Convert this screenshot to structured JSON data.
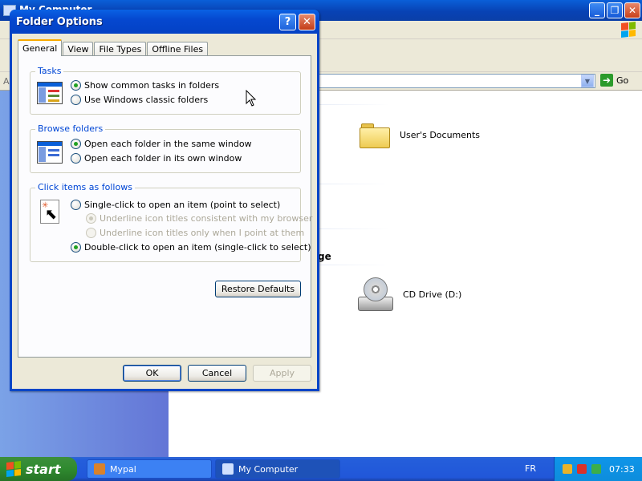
{
  "background_window": {
    "title": "My Computer",
    "address_prefix": "A",
    "go_label": "Go",
    "items": [
      {
        "label": "User's Documents",
        "icon": "folder-icon"
      },
      {
        "label": "CD Drive (D:)",
        "icon": "cd-drive-icon"
      }
    ],
    "section_fragment": "ge"
  },
  "dialog": {
    "title": "Folder Options",
    "help_glyph": "?",
    "close_glyph": "✕",
    "tabs": [
      {
        "label": "General",
        "active": true
      },
      {
        "label": "View"
      },
      {
        "label": "File Types"
      },
      {
        "label": "Offline Files"
      }
    ],
    "groups": {
      "tasks": {
        "title": "Tasks",
        "options": [
          {
            "label": "Show common tasks in folders",
            "checked": true
          },
          {
            "label": "Use Windows classic folders",
            "checked": false
          }
        ]
      },
      "browse": {
        "title": "Browse folders",
        "options": [
          {
            "label": "Open each folder in the same window",
            "checked": true
          },
          {
            "label": "Open each folder in its own window",
            "checked": false
          }
        ]
      },
      "click": {
        "title": "Click items as follows",
        "options": [
          {
            "label": "Single-click to open an item (point to select)",
            "checked": false
          },
          {
            "label": "Underline icon titles consistent with my browser",
            "checked": true,
            "disabled": true
          },
          {
            "label": "Underline icon titles only when I point at them",
            "checked": false,
            "disabled": true
          },
          {
            "label": "Double-click to open an item (single-click to select)",
            "checked": true
          }
        ]
      }
    },
    "restore_defaults": "Restore Defaults",
    "ok": "OK",
    "cancel": "Cancel",
    "apply": "Apply"
  },
  "taskbar": {
    "start_label": "start",
    "tasks": [
      {
        "label": "Mypal"
      },
      {
        "label": "My Computer",
        "active": true
      }
    ],
    "language": "FR",
    "clock": "07:33"
  },
  "colors": {
    "titlebar": "#0845c7",
    "group_title": "#0046d5",
    "dialog_face": "#ece9d8",
    "left_pane": "#6f8fe0"
  }
}
